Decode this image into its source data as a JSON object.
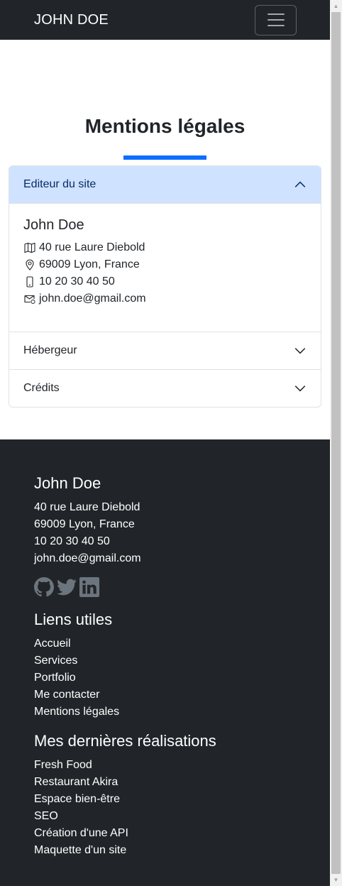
{
  "nav": {
    "brand": "JOHN DOE"
  },
  "title": "Mentions légales",
  "accordion": [
    {
      "label": "Editeur du site",
      "expanded": true
    },
    {
      "label": "Hébergeur",
      "expanded": false
    },
    {
      "label": "Crédits",
      "expanded": false
    }
  ],
  "editor": {
    "name": "John Doe",
    "address": "40 rue Laure Diebold",
    "city": "69009 Lyon, France",
    "phone": "10 20 30 40 50",
    "email": "john.doe@gmail.com"
  },
  "footer": {
    "name": "John Doe",
    "address": "40 rue Laure Diebold",
    "city": "69009 Lyon, France",
    "phone": "10 20 30 40 50",
    "email": "john.doe@gmail.com",
    "socials": [
      "github-icon",
      "twitter-icon",
      "linkedin-icon"
    ],
    "links_title": "Liens utiles",
    "links": [
      "Accueil",
      "Services",
      "Portfolio",
      "Me contacter",
      "Mentions légales"
    ],
    "works_title": "Mes dernières réalisations",
    "works": [
      "Fresh Food",
      "Restaurant Akira",
      "Espace bien-être",
      "SEO",
      "Création d'une API",
      "Maquette d'un site"
    ]
  },
  "colors": {
    "dark": "#212529",
    "accent": "#0d6efd",
    "accordion_active": "#cfe2ff"
  }
}
